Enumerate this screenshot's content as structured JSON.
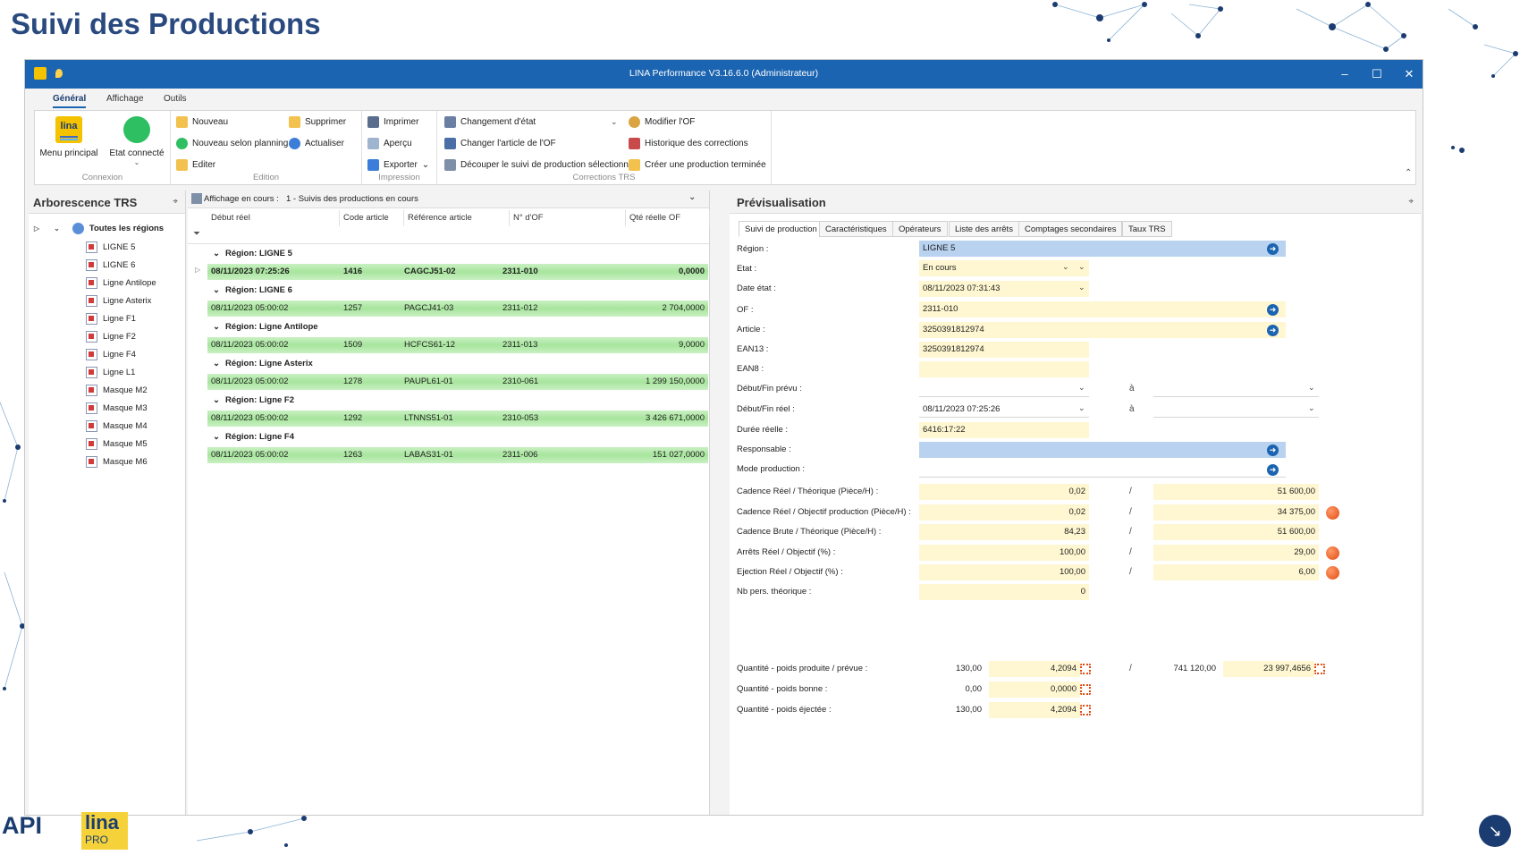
{
  "slide": {
    "title": "Suivi des Productions"
  },
  "window": {
    "title": "LINA Performance  V3.16.6.0  (Administrateur)"
  },
  "ribbon": {
    "tabs": [
      "Général",
      "Affichage",
      "Outils"
    ],
    "connexion": {
      "menu": "Menu principal",
      "etat": "Etat connecté",
      "label": "Connexion"
    },
    "edition": {
      "nouveau": "Nouveau",
      "supprimer": "Supprimer",
      "nouveau_planning": "Nouveau selon planning",
      "actualiser": "Actualiser",
      "editer": "Editer",
      "label": "Edition"
    },
    "impression": {
      "imprimer": "Imprimer",
      "apercu": "Aperçu",
      "exporter": "Exporter",
      "label": "Impression"
    },
    "corrections": {
      "changement": "Changement d'état",
      "modifier_of": "Modifier l'OF",
      "changer_article": "Changer l'article de l'OF",
      "historique": "Historique des corrections",
      "decouper": "Découper le suivi de production sélectionné",
      "creer": "Créer une production terminée",
      "label": "Corrections TRS"
    }
  },
  "tree": {
    "title": "Arborescence TRS",
    "root": "Toutes les régions",
    "items": [
      "LIGNE 5",
      "LIGNE 6",
      "Ligne Antilope",
      "Ligne Asterix",
      "Ligne F1",
      "Ligne F2",
      "Ligne F4",
      "Ligne L1",
      "Masque M2",
      "Masque M3",
      "Masque M4",
      "Masque M5",
      "Masque M6"
    ]
  },
  "grid": {
    "display_label": "Affichage en cours :",
    "display_value": "1 - Suivis des productions en cours",
    "columns": [
      "Début réel",
      "Code article",
      "Référence article",
      "N° d'OF",
      "Qté réelle OF"
    ],
    "groups": [
      {
        "label": "Région: LIGNE 5",
        "row": [
          "08/11/2023 07:25:26",
          "1416",
          "CAGCJ51-02",
          "2311-010",
          "0,0000"
        ]
      },
      {
        "label": "Région: LIGNE 6",
        "row": [
          "08/11/2023 05:00:02",
          "1257",
          "PAGCJ41-03",
          "2311-012",
          "2 704,0000"
        ]
      },
      {
        "label": "Région: Ligne Antilope",
        "row": [
          "08/11/2023 05:00:02",
          "1509",
          "HCFCS61-12",
          "2311-013",
          "9,0000"
        ]
      },
      {
        "label": "Région: Ligne Asterix",
        "row": [
          "08/11/2023 05:00:02",
          "1278",
          "PAUPL61-01",
          "2310-061",
          "1 299 150,0000"
        ]
      },
      {
        "label": "Région: Ligne F2",
        "row": [
          "08/11/2023 05:00:02",
          "1292",
          "LTNNS51-01",
          "2310-053",
          "3 426 671,0000"
        ]
      },
      {
        "label": "Région: Ligne F4",
        "row": [
          "08/11/2023 05:00:02",
          "1263",
          "LABAS31-01",
          "2311-006",
          "151 027,0000"
        ]
      }
    ]
  },
  "preview": {
    "title": "Prévisualisation",
    "tabs": [
      "Suivi de production",
      "Caractéristiques",
      "Opérateurs",
      "Liste des arrêts",
      "Comptages secondaires",
      "Taux TRS"
    ],
    "labels": {
      "region": "Région :",
      "etat": "Etat :",
      "date_etat": "Date état :",
      "of": "OF :",
      "article": "Article :",
      "ean13": "EAN13 :",
      "ean8": "EAN8 :",
      "debut_fin_prevu": "Début/Fin prévu :",
      "debut_fin_reel": "Début/Fin réel :",
      "duree": "Durée réelle :",
      "responsable": "Responsable :",
      "mode": "Mode production :",
      "cad_theo": "Cadence Réel / Théorique (Pièce/H) :",
      "cad_obj": "Cadence Réel / Objectif production (Pièce/H) :",
      "cad_brute": "Cadence Brute / Théorique (Pièce/H) :",
      "arrets": "Arrêts Réel / Objectif (%) :",
      "ejection": "Ejection Réel / Objectif (%) :",
      "nb_pers": "Nb pers. théorique :",
      "qte_prod": "Quantité - poids produite / prévue :",
      "qte_bonne": "Quantité - poids bonne :",
      "qte_eject": "Quantité - poids éjectée :"
    },
    "values": {
      "region": "LIGNE 5",
      "etat": "En cours",
      "date_etat": "08/11/2023 07:31:43",
      "of": "2311-010",
      "article": "3250391812974",
      "ean13": "3250391812974",
      "ean8": "",
      "debut_reel": "08/11/2023 07:25:26",
      "a": "à",
      "duree": "6416:17:22",
      "cad_theo": [
        "0,02",
        "51 600,00"
      ],
      "cad_obj": [
        "0,02",
        "34 375,00"
      ],
      "cad_brute": [
        "84,23",
        "51 600,00"
      ],
      "arrets": [
        "100,00",
        "29,00"
      ],
      "ejection": [
        "100,00",
        "6,00"
      ],
      "nb_pers": "0",
      "qte_prod": [
        "130,00",
        "4,2094",
        "741 120,00",
        "23 997,4656"
      ],
      "qte_bonne": [
        "0,00",
        "0,0000"
      ],
      "qte_eject": [
        "130,00",
        "4,2094"
      ],
      "slash": "/"
    }
  },
  "branding": {
    "api": "API",
    "lina": "lina",
    "pro": "PRO"
  }
}
